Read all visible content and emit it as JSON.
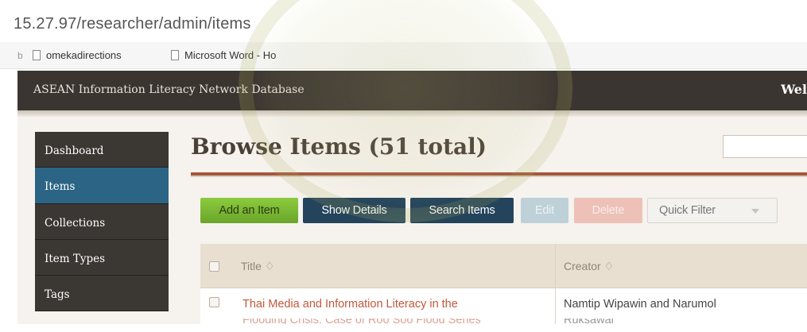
{
  "browser": {
    "url": "15.27.97/researcher/admin/items",
    "bookmarks": [
      {
        "label": "omekadirections"
      },
      {
        "label": "Microsoft Word - Ho"
      }
    ]
  },
  "header": {
    "site_title": "ASEAN Information Literacy Network Database",
    "welcome": "Wel"
  },
  "sidebar": {
    "items": [
      {
        "label": "Dashboard",
        "active": false
      },
      {
        "label": "Items",
        "active": true
      },
      {
        "label": "Collections",
        "active": false
      },
      {
        "label": "Item Types",
        "active": false
      },
      {
        "label": "Tags",
        "active": false
      }
    ]
  },
  "main": {
    "title": "Browse Items (51 total)",
    "toolbar": {
      "add": "Add an Item",
      "show_details": "Show Details",
      "search": "Search Items",
      "edit": "Edit",
      "delete": "Delete",
      "quick_filter": "Quick Filter"
    },
    "table": {
      "columns": [
        "Title ♢",
        "Creator ♢"
      ],
      "rows": [
        {
          "title": "Thai Media and Information Literacy in the",
          "title_cont": "Flooding Crisis: Case of Roo Soo Flood Series",
          "creator": "Namtip Wipawin and Narumol",
          "creator_cont": "Ruksawai"
        }
      ]
    }
  },
  "colors": {
    "header_bg": "#3b3531",
    "active_nav": "#2b6485",
    "add_button": "#7ab934",
    "primary_button": "#24445c",
    "link": "#c3573a",
    "rule": "#a4583c"
  }
}
